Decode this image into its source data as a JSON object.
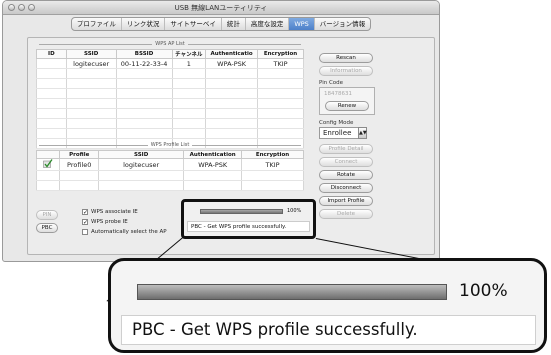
{
  "window": {
    "title": "USB 無線LANユーティリティ"
  },
  "tabs": [
    {
      "label": "プロファイル",
      "active": false
    },
    {
      "label": "リンク状況",
      "active": false
    },
    {
      "label": "サイトサーベイ",
      "active": false
    },
    {
      "label": "統計",
      "active": false
    },
    {
      "label": "高度な設定",
      "active": false
    },
    {
      "label": "WPS",
      "active": true
    },
    {
      "label": "バージョン情報",
      "active": false
    }
  ],
  "ap_list": {
    "legend": "WPS AP List",
    "columns": [
      "ID",
      "SSID",
      "BSSID",
      "チャンネル",
      "Authenticatio",
      "Encryption"
    ],
    "rows": [
      [
        "",
        "logitecuser",
        "00-11-22-33-4",
        "1",
        "WPA-PSK",
        "TKIP"
      ]
    ]
  },
  "profile_list": {
    "legend": "WPS Profile List",
    "columns": [
      "",
      "Profile",
      "SSID",
      "Authentication",
      "Encryption"
    ],
    "rows": [
      [
        "",
        "Profile0",
        "logitecuser",
        "WPA-PSK",
        "TKIP"
      ]
    ]
  },
  "side": {
    "rescan": "Rescan",
    "information": "Information",
    "pin_code_label": "Pin Code",
    "pin_code_value": "18478631",
    "renew": "Renew",
    "config_mode_label": "Config Mode",
    "config_mode_value": "Enrollee",
    "profile_detail": "Profile Detail",
    "connect": "Connect",
    "rotate": "Rotate",
    "disconnect": "Disconnect",
    "import_profile": "Import Profile",
    "delete": "Delete"
  },
  "bottom": {
    "pin_button": "PIN",
    "pbc_button": "PBC",
    "wps_associate_ie": "WPS associate IE",
    "wps_probe_ie": "WPS probe IE",
    "auto_select": "Automatically select the AP",
    "wps_associate_checked": true,
    "wps_probe_checked": true,
    "auto_select_checked": false
  },
  "status": {
    "progress_percent": 100,
    "progress_label": "100%",
    "message": "PBC - Get WPS profile successfully."
  },
  "colors": {
    "active_tab": "#4d80c9",
    "callout_border": "#111111"
  }
}
